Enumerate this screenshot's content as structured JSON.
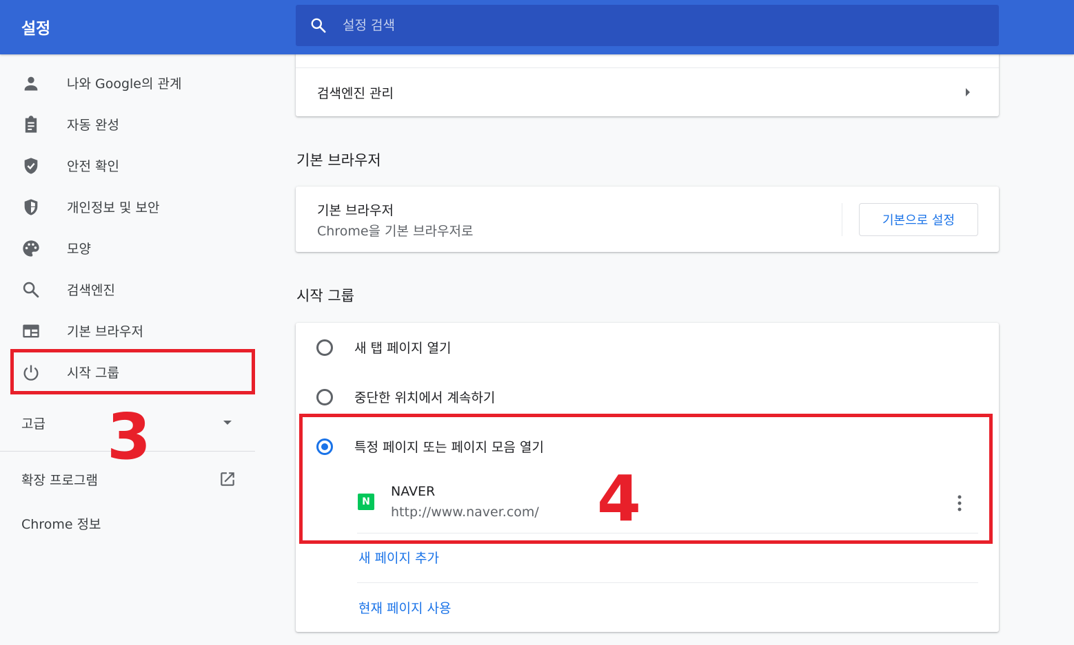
{
  "app": {
    "title": "설정"
  },
  "search": {
    "placeholder": "설정 검색"
  },
  "sidebar": {
    "items": [
      {
        "label": "나와 Google의 관계",
        "icon": "person-icon"
      },
      {
        "label": "자동 완성",
        "icon": "clipboard-icon"
      },
      {
        "label": "안전 확인",
        "icon": "shield-check-icon"
      },
      {
        "label": "개인정보 및 보안",
        "icon": "shield-half-icon"
      },
      {
        "label": "모양",
        "icon": "palette-icon"
      },
      {
        "label": "검색엔진",
        "icon": "search-icon"
      },
      {
        "label": "기본 브라우저",
        "icon": "browser-window-icon"
      },
      {
        "label": "시작 그룹",
        "icon": "power-icon"
      }
    ],
    "advanced_label": "고급",
    "extensions_label": "확장 프로그램",
    "about_label": "Chrome 정보"
  },
  "annotations": {
    "step3": "3",
    "step4": "4",
    "color": "#e8202a"
  },
  "search_engine": {
    "manage_label": "검색엔진 관리"
  },
  "default_browser": {
    "section_title": "기본 브라우저",
    "row_title": "기본 브라우저",
    "row_sub": "Chrome을 기본 브라우저로",
    "button_label": "기본으로 설정"
  },
  "startup": {
    "section_title": "시작 그룹",
    "options": [
      {
        "label": "새 탭 페이지 열기",
        "checked": false
      },
      {
        "label": "중단한 위치에서 계속하기",
        "checked": false
      },
      {
        "label": "특정 페이지 또는 페이지 모음 열기",
        "checked": true
      }
    ],
    "pages": [
      {
        "name": "NAVER",
        "url": "http://www.naver.com/",
        "favicon_letter": "N",
        "favicon_color": "#03c75a"
      }
    ],
    "add_page_label": "새 페이지 추가",
    "use_current_label": "현재 페이지 사용"
  },
  "colors": {
    "header": "#3367d6",
    "search_bg": "#2a52be",
    "accent": "#1a73e8"
  }
}
